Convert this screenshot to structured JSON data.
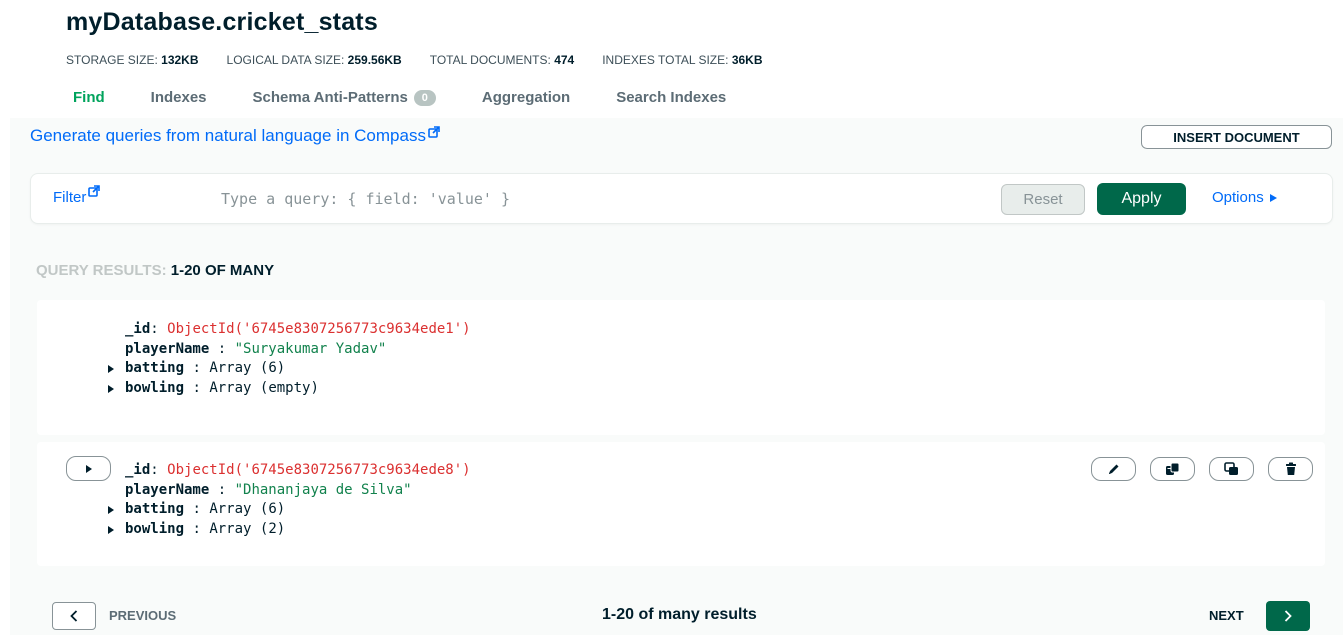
{
  "header": {
    "title": "myDatabase.cricket_stats"
  },
  "stats": [
    {
      "label": "Storage size:",
      "value": "132KB"
    },
    {
      "label": "Logical data size:",
      "value": "259.56KB"
    },
    {
      "label": "Total documents:",
      "value": "474"
    },
    {
      "label": "Indexes total size:",
      "value": "36KB"
    }
  ],
  "tabs": [
    {
      "label": "Find",
      "active": true
    },
    {
      "label": "Indexes"
    },
    {
      "label": "Schema Anti-Patterns",
      "count": "0"
    },
    {
      "label": "Aggregation"
    },
    {
      "label": "Search Indexes"
    }
  ],
  "toolbar": {
    "nl_query_link": "Generate queries from natural language in Compass",
    "insert_document": "Insert Document"
  },
  "query": {
    "filter_label": "Filter",
    "placeholder": "Type a query: { field: 'value' }",
    "value": "",
    "reset": "Reset",
    "apply": "Apply",
    "options": "Options"
  },
  "results": {
    "label_prefix": "Query results:",
    "label_value": "1-20 of many"
  },
  "documents": [
    {
      "fields": {
        "id_key": "_id",
        "id_value": "ObjectId('6745e8307256773c9634ede1')",
        "name_key": "playerName",
        "name_value": "\"Suryakumar Yadav\"",
        "batting_key": "batting",
        "batting_value": "Array (6)",
        "bowling_key": "bowling",
        "bowling_value": "Array (empty)"
      }
    },
    {
      "fields": {
        "id_key": "_id",
        "id_value": "ObjectId('6745e8307256773c9634ede8')",
        "name_key": "playerName",
        "name_value": "\"Dhananjaya de Silva\"",
        "batting_key": "batting",
        "batting_value": "Array (6)",
        "bowling_key": "bowling",
        "bowling_value": "Array (2)"
      }
    }
  ],
  "doc_actions_icons": [
    "pencil-icon",
    "copy-icon",
    "clone-icon",
    "trash-icon"
  ],
  "pagination": {
    "previous": "Previous",
    "summary": "1-20 of many results",
    "next": "Next"
  },
  "colors": {
    "accent_green": "#00a35c",
    "button_green": "#00684a",
    "link_blue": "#016bf8",
    "objectid_red": "#db3030",
    "string_green": "#12824d"
  }
}
